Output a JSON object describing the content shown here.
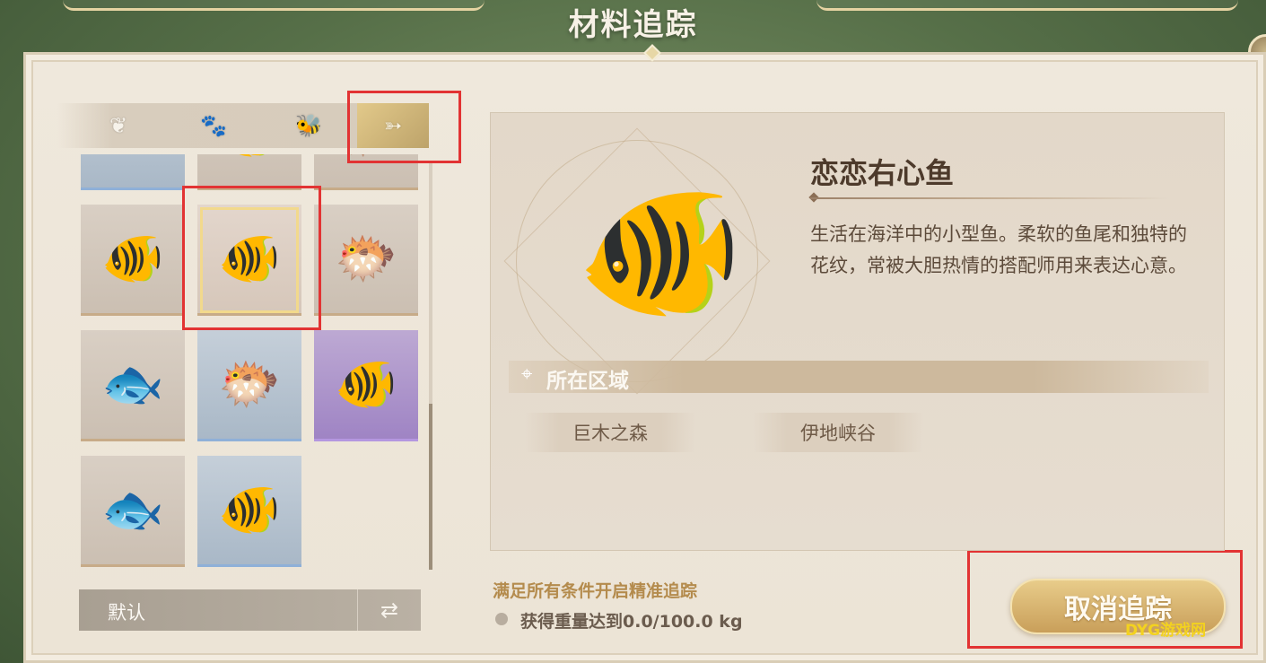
{
  "window": {
    "title": "材料追踪"
  },
  "tabs": [
    {
      "icon": "leaf-icon",
      "glyph": "❦"
    },
    {
      "icon": "paw-icon",
      "glyph": "🐾"
    },
    {
      "icon": "bee-icon",
      "glyph": "🐝"
    },
    {
      "icon": "fish-icon",
      "glyph": "➳"
    }
  ],
  "grid": {
    "cells": [
      {
        "fish": "pink-fish-partial",
        "glyph": "🐟",
        "style": "blue"
      },
      {
        "fish": "purple-fish-partial",
        "glyph": "🐠",
        "style": "tan"
      },
      {
        "fish": "orange-fish-partial",
        "glyph": "🐡",
        "style": "tan"
      },
      {
        "fish": "heart-fish",
        "glyph": "🐠",
        "style": "tan"
      },
      {
        "fish": "heart-fish-selected",
        "glyph": "🐠",
        "style": "tan"
      },
      {
        "fish": "spiky-fish",
        "glyph": "🐡",
        "style": "tan"
      },
      {
        "fish": "long-fish",
        "glyph": "🐟",
        "style": "tan"
      },
      {
        "fish": "skull-fish",
        "glyph": "🐡",
        "style": "blue"
      },
      {
        "fish": "violet-fish",
        "glyph": "🐠",
        "style": "purple"
      },
      {
        "fish": "betta-fish",
        "glyph": "🐟",
        "style": "tan"
      },
      {
        "fish": "blue-fin-fish",
        "glyph": "🐠",
        "style": "blue"
      }
    ]
  },
  "sort": {
    "label": "默认",
    "toggle_glyph": "⇄"
  },
  "detail": {
    "name": "恋恋右心鱼",
    "description": "生活在海洋中的小型鱼。柔软的鱼尾和独特的花纹，常被大胆热情的搭配师用来表达心意。",
    "image_glyph": "🐠",
    "region_title": "所在区域",
    "pin_glyph": "⌖",
    "regions": [
      "巨木之森",
      "伊地峡谷"
    ]
  },
  "conditions": {
    "title": "满足所有条件开启精准追踪",
    "items": [
      "获得重量达到0.0/100.0 kg"
    ]
  },
  "actions": {
    "cancel_tracking": "取消追踪"
  },
  "watermark": "DYG游戏网",
  "colors": {
    "highlight_box": "#e23333",
    "accent_gold": "#c99f5a",
    "bg_green": "#566f48"
  }
}
